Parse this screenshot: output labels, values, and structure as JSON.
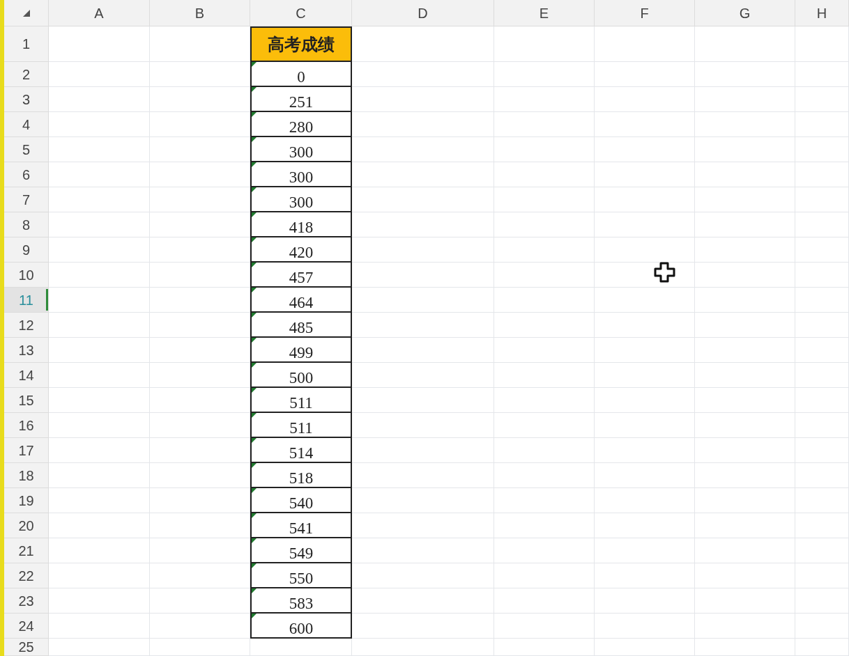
{
  "column_headers": [
    "A",
    "B",
    "C",
    "D",
    "E",
    "F",
    "G",
    "H"
  ],
  "row_headers": [
    {
      "label": "1",
      "selected": false
    },
    {
      "label": "2",
      "selected": false
    },
    {
      "label": "3",
      "selected": false
    },
    {
      "label": "4",
      "selected": false
    },
    {
      "label": "5",
      "selected": false
    },
    {
      "label": "6",
      "selected": false
    },
    {
      "label": "7",
      "selected": false
    },
    {
      "label": "8",
      "selected": false
    },
    {
      "label": "9",
      "selected": false
    },
    {
      "label": "10",
      "selected": false
    },
    {
      "label": "11",
      "selected": true
    },
    {
      "label": "12",
      "selected": false
    },
    {
      "label": "13",
      "selected": false
    },
    {
      "label": "14",
      "selected": false
    },
    {
      "label": "15",
      "selected": false
    },
    {
      "label": "16",
      "selected": false
    },
    {
      "label": "17",
      "selected": false
    },
    {
      "label": "18",
      "selected": false
    },
    {
      "label": "19",
      "selected": false
    },
    {
      "label": "20",
      "selected": false
    },
    {
      "label": "21",
      "selected": false
    },
    {
      "label": "22",
      "selected": false
    },
    {
      "label": "23",
      "selected": false
    },
    {
      "label": "24",
      "selected": false
    },
    {
      "label": "25",
      "selected": false
    }
  ],
  "column_c": {
    "header": "高考成绩",
    "cells": [
      {
        "value": "0",
        "number_as_text": true
      },
      {
        "value": "251",
        "number_as_text": true
      },
      {
        "value": "280",
        "number_as_text": true
      },
      {
        "value": "300",
        "number_as_text": true
      },
      {
        "value": "300",
        "number_as_text": true
      },
      {
        "value": "300",
        "number_as_text": true
      },
      {
        "value": "418",
        "number_as_text": true
      },
      {
        "value": "420",
        "number_as_text": true
      },
      {
        "value": "457",
        "number_as_text": true
      },
      {
        "value": "464",
        "number_as_text": true
      },
      {
        "value": "485",
        "number_as_text": true
      },
      {
        "value": "499",
        "number_as_text": true
      },
      {
        "value": "500",
        "number_as_text": true
      },
      {
        "value": "511",
        "number_as_text": true
      },
      {
        "value": "511",
        "number_as_text": true
      },
      {
        "value": "514",
        "number_as_text": true
      },
      {
        "value": "518",
        "number_as_text": true
      },
      {
        "value": "540",
        "number_as_text": true
      },
      {
        "value": "541",
        "number_as_text": true
      },
      {
        "value": "549",
        "number_as_text": true
      },
      {
        "value": "550",
        "number_as_text": true
      },
      {
        "value": "583",
        "number_as_text": true
      },
      {
        "value": "600",
        "number_as_text": true
      }
    ]
  }
}
